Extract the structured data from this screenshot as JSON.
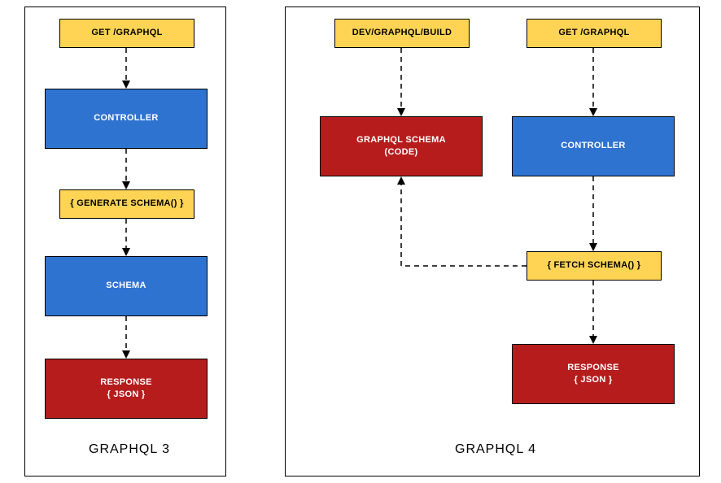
{
  "panels": {
    "left": {
      "label": "GRAPHQL 3",
      "boxes": {
        "request": "GET /GRAPHQL",
        "controller": "CONTROLLER",
        "generate": "{  GENERATE SCHEMA()  }",
        "schema": "SCHEMA",
        "response_l1": "RESPONSE",
        "response_l2": "{ JSON }"
      }
    },
    "right": {
      "label": "GRAPHQL 4",
      "boxes": {
        "build": "DEV/GRAPHQL/BUILD",
        "request": "GET /GRAPHQL",
        "schema_l1": "GRAPHQL SCHEMA",
        "schema_l2": "(CODE)",
        "controller": "CONTROLLER",
        "fetch": "{  FETCH SCHEMA()  }",
        "response_l1": "RESPONSE",
        "response_l2": "{ JSON }"
      }
    }
  },
  "colors": {
    "yellow": "#ffd454",
    "blue": "#2f73d1",
    "red": "#b71c1c"
  }
}
